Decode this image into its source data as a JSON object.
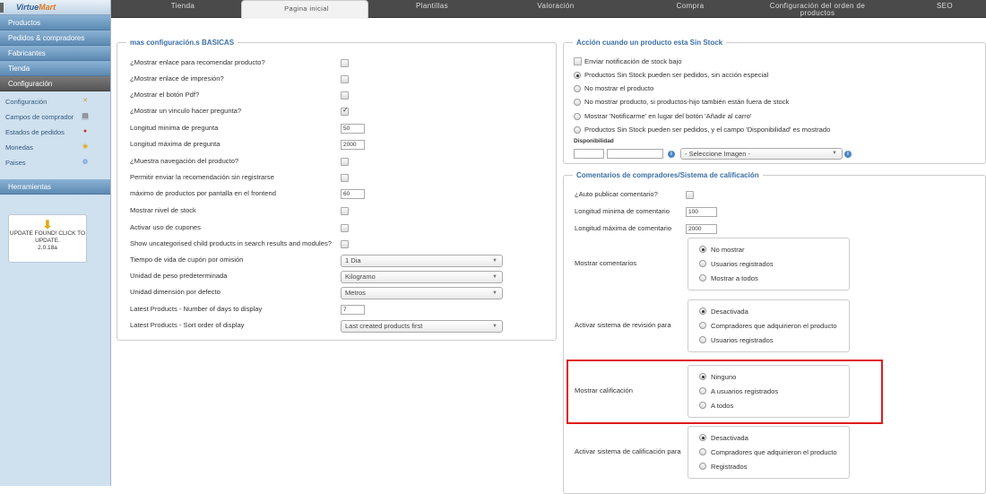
{
  "sidebar": {
    "logo": "VirtueMart",
    "logo_accent": "Mart",
    "items": [
      {
        "label": "Productos",
        "active": false
      },
      {
        "label": "Pedidos & compradores",
        "active": false
      },
      {
        "label": "Fabricantes",
        "active": false
      },
      {
        "label": "Tienda",
        "active": false
      },
      {
        "label": "Configuración",
        "active": true
      }
    ],
    "subitems": [
      {
        "label": "Configuración",
        "icon": "wrench-icon"
      },
      {
        "label": "Campos de comprador",
        "icon": "form-icon"
      },
      {
        "label": "Estados de pedidos",
        "icon": "status-icon"
      },
      {
        "label": "Monedas",
        "icon": "coins-icon"
      },
      {
        "label": "Paises",
        "icon": "globe-icon"
      }
    ],
    "tools_label": "Herramientas",
    "update_notice": "UPDATE FOUND! CLICK TO UPDATE.",
    "update_version": "2.0.18a"
  },
  "tabs": [
    {
      "label": "Tienda"
    },
    {
      "label": "Pagina inicial",
      "selected": true
    },
    {
      "label": "Plantillas"
    },
    {
      "label": "Valoración"
    },
    {
      "label": "Compra"
    },
    {
      "label": "Configuración del orden de productos"
    },
    {
      "label": "SEO"
    }
  ],
  "basic": {
    "legend": "mas configuración.s BASICAS",
    "rows": [
      {
        "label": "¿Mostrar enlace para recomendar producto?",
        "type": "checkbox",
        "checked": false
      },
      {
        "label": "¿Mostrar enlace de impresión?",
        "type": "checkbox",
        "checked": false
      },
      {
        "label": "¿Mostrar el botón Pdf?",
        "type": "checkbox",
        "checked": false
      },
      {
        "label": "¿Mostrar un vinculo hacer pregunta?",
        "type": "checkbox",
        "checked": true
      },
      {
        "label": "Longitud minima de pregunta",
        "type": "text",
        "value": "50"
      },
      {
        "label": "Longitud máxima de pregunta",
        "type": "text",
        "value": "2000"
      },
      {
        "label": "¿Muestra navegación del producto?",
        "type": "checkbox",
        "checked": false
      },
      {
        "label": "Permitir enviar la recomendación sin registrarse",
        "type": "checkbox",
        "checked": false
      },
      {
        "label": "máximo de productos por pantalla en el frontend",
        "type": "text",
        "value": "60"
      },
      {
        "label": "Mostrar nivel de stock",
        "type": "checkbox",
        "checked": false
      },
      {
        "label": "Activar uso de cupones",
        "type": "checkbox",
        "checked": false
      },
      {
        "label": "Show uncategorised child products in search results and modules?",
        "type": "checkbox",
        "checked": false
      },
      {
        "label": "Tiempo de vida de cupón por omisión",
        "type": "select",
        "value": "1 Dia"
      },
      {
        "label": "Unidad de peso predeterminada",
        "type": "select",
        "value": "Kilogramo"
      },
      {
        "label": "Unidad dimensión por defecto",
        "type": "select",
        "value": "Metros"
      },
      {
        "label": "Latest Products - Number of days to display",
        "type": "text",
        "value": "7"
      },
      {
        "label": "Latest Products - Sort order of display",
        "type": "select",
        "value": "Last created products first"
      }
    ]
  },
  "stock": {
    "legend": "Acción cuando un producto esta Sin Stock",
    "notify_label": "Enviar notificación de stock bajo",
    "options": [
      {
        "label": "Productos Sin Stock pueden ser pedidos, sin acción especial",
        "selected": true
      },
      {
        "label": "No mostrar el producto",
        "selected": false
      },
      {
        "label": "No mostrar producto, si productos-hijo también están fuera de stock",
        "selected": false
      },
      {
        "label": "Mostrar 'Notificarme' en lugar del botón 'Añadir al carro'",
        "selected": false
      },
      {
        "label": "Productos Sin Stock pueden ser pedidos, y el campo 'Disponibilidad' es mostrado",
        "selected": false
      }
    ],
    "availability_label": "Disponibilidad",
    "image_select": "- Seleccione Imagen -"
  },
  "reviews": {
    "legend": "Comentarios de compradores/Sistema de calificación",
    "auto_publish_label": "¿Auto publicar comentario?",
    "min_len_label": "Longitud minima de comentario",
    "min_len_value": "100",
    "max_len_label": "Longitud máxima de comentario",
    "max_len_value": "2000",
    "groups": [
      {
        "label": "Mostrar comentarios",
        "options": [
          {
            "label": "No mostrar",
            "selected": true
          },
          {
            "label": "Usuarios registrados",
            "selected": false
          },
          {
            "label": "Mostrar a todos",
            "selected": false
          }
        ]
      },
      {
        "label": "Activar sistema de revisión para",
        "options": [
          {
            "label": "Desactivada",
            "selected": true
          },
          {
            "label": "Compradores que adquirieron el producto",
            "selected": false
          },
          {
            "label": "Usuarios registrados",
            "selected": false
          }
        ]
      },
      {
        "label": "Mostrar calificación",
        "options": [
          {
            "label": "Ninguno",
            "selected": true
          },
          {
            "label": "A usuarios registrados",
            "selected": false
          },
          {
            "label": "A todos",
            "selected": false
          }
        ]
      },
      {
        "label": "Activar sistema de calificación para",
        "options": [
          {
            "label": "Desactivada",
            "selected": true
          },
          {
            "label": "Compradores que adquirieron el producto",
            "selected": false
          },
          {
            "label": "Registrados",
            "selected": false
          }
        ]
      }
    ]
  }
}
